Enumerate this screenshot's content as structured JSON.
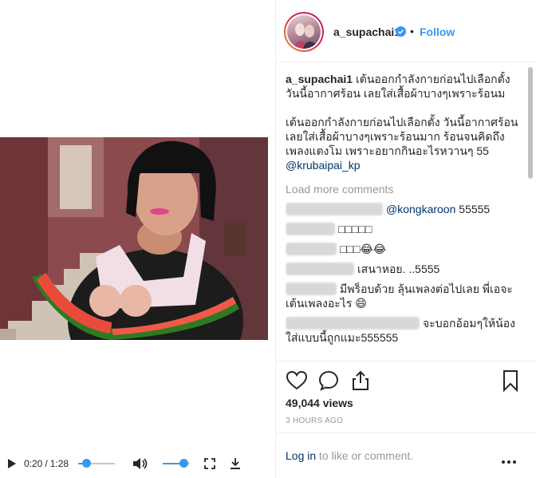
{
  "video": {
    "current_time": "0:20",
    "duration": "1:28",
    "progress": 0.227,
    "volume": 0.75
  },
  "post": {
    "username": "a_supachai1",
    "follow_label": "Follow",
    "dot": "•",
    "caption_text": "เต้นออกกำลังกายก่อนไปเลือกตั้ง วันนี้อากาศร้อน เลยใส่เสื้อผ้าบางๆเพราะร้อนม",
    "caption2_text": "เต้นออกกำลังกายก่อนไปเลือกตั้ง วันนี้อากาศร้อน เลยใส่เสื้อผ้าบางๆเพราะร้อนมาก ร้อนจนคิดถึงเพลงแตงโม เพราะอยากกินอะไรหวานๆ 55",
    "caption2_mention": "@krubaipai_kp",
    "load_more": "Load more comments",
    "comments": [
      {
        "mention": "@kongkaroon",
        "text": "55555"
      },
      {
        "mention": "",
        "text": "□□□□□"
      },
      {
        "mention": "",
        "text": "□□□😂😂"
      },
      {
        "mention": "",
        "text": "เสนาหอย. ..5555"
      },
      {
        "mention": "",
        "text": "มีพร็อบด้วย ลุ้นเพลงต่อไปเลย พี่เอจะเต้นเพลงอะไร 😄"
      },
      {
        "mention": "",
        "text": "จะบอกอ้อมๆให้น้องใส่แบบนี้ถูกแมะ555555"
      }
    ],
    "views": "49,044 views",
    "time_ago": "3 HOURS AGO",
    "login_link": "Log in",
    "login_suffix": " to like or comment."
  },
  "icons": {
    "play": "play-icon",
    "volume": "volume-icon",
    "fullscreen": "fullscreen-icon",
    "download": "download-icon",
    "like": "heart-icon",
    "comment": "comment-icon",
    "share": "share-icon",
    "save": "bookmark-icon",
    "more": "more-options-icon",
    "verified": "verified-badge-icon"
  },
  "colors": {
    "link_blue": "#3897f0",
    "mention_blue": "#003569",
    "muted": "#999999"
  }
}
